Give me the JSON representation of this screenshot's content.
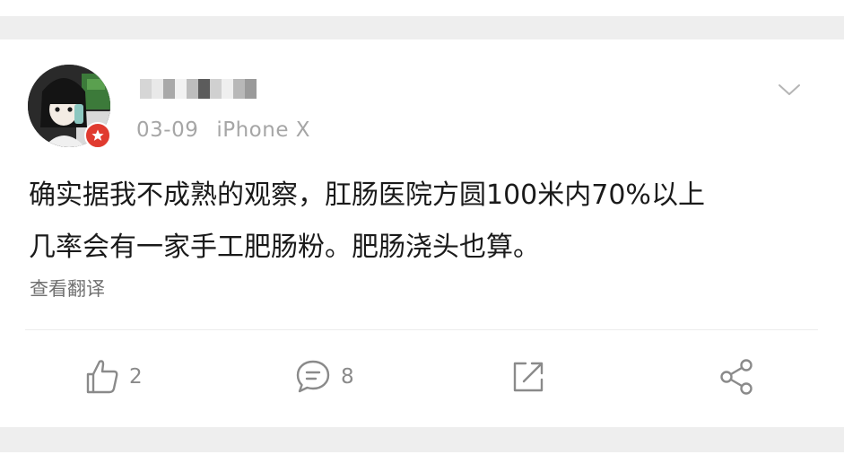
{
  "post": {
    "username_obscured": true,
    "date": "03-09",
    "device": "iPhone X",
    "content_lines": [
      "确实据我不成熟的观察，肛肠医院方圆100米内70%以上",
      "几率会有一家手工肥肠粉。肥肠浇头也算。"
    ],
    "translate_label": "查看翻译",
    "more_icon": "chevron-down-icon",
    "verified_badge_icon": "star-icon",
    "badge_color": "#e03a2f"
  },
  "actions": {
    "like": {
      "icon": "thumbs-up-icon",
      "count": "2"
    },
    "comment": {
      "icon": "comment-icon",
      "count": "8"
    },
    "repost": {
      "icon": "repost-icon"
    },
    "share": {
      "icon": "share-icon"
    }
  },
  "colors": {
    "text": "#1a1a1a",
    "meta": "#a6a6a6",
    "icon": "#8a8a8a",
    "separator_bg": "#eeeeee"
  }
}
